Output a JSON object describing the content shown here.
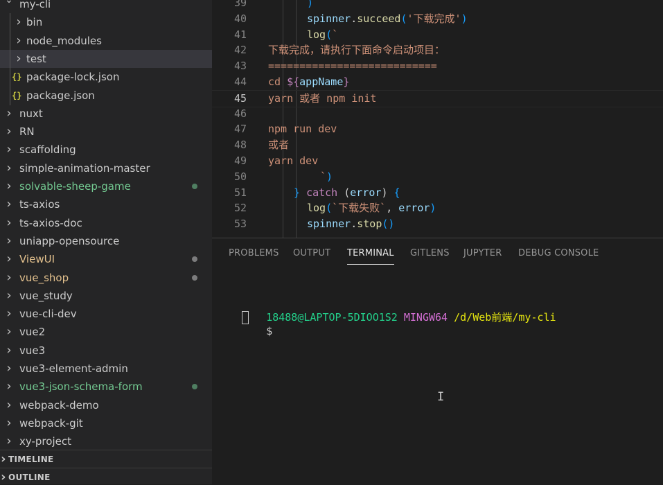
{
  "explorer": {
    "root_folder": "my-cli",
    "root_children": [
      {
        "label": "bin",
        "kind": "folder",
        "selected": false
      },
      {
        "label": "node_modules",
        "kind": "folder",
        "selected": false
      },
      {
        "label": "test",
        "kind": "folder",
        "selected": true
      },
      {
        "label": "package-lock.json",
        "kind": "json",
        "json_icon": "{}",
        "selected": false
      },
      {
        "label": "package.json",
        "kind": "json",
        "json_icon": "{}",
        "selected": false
      }
    ],
    "folders": [
      {
        "label": "nuxt",
        "color": "#cccccc",
        "modified": false
      },
      {
        "label": "RN",
        "color": "#cccccc",
        "modified": false
      },
      {
        "label": "scaffolding",
        "color": "#cccccc",
        "modified": false
      },
      {
        "label": "simple-animation-master",
        "color": "#cccccc",
        "modified": false
      },
      {
        "label": "solvable-sheep-game",
        "color": "#73c991",
        "modified": true,
        "dot_color": "#73c991"
      },
      {
        "label": "ts-axios",
        "color": "#cccccc",
        "modified": false
      },
      {
        "label": "ts-axios-doc",
        "color": "#cccccc",
        "modified": false
      },
      {
        "label": "uniapp-opensource",
        "color": "#cccccc",
        "modified": false
      },
      {
        "label": "ViewUI",
        "color": "#e2c08d",
        "modified": true,
        "dot_color": "#c5c5c5"
      },
      {
        "label": "vue_shop",
        "color": "#e2c08d",
        "modified": true,
        "dot_color": "#c5c5c5"
      },
      {
        "label": "vue_study",
        "color": "#cccccc",
        "modified": false
      },
      {
        "label": "vue-cli-dev",
        "color": "#cccccc",
        "modified": false
      },
      {
        "label": "vue2",
        "color": "#cccccc",
        "modified": false
      },
      {
        "label": "vue3",
        "color": "#cccccc",
        "modified": false
      },
      {
        "label": "vue3-element-admin",
        "color": "#cccccc",
        "modified": false
      },
      {
        "label": "vue3-json-schema-form",
        "color": "#73c991",
        "modified": true,
        "dot_color": "#73c991"
      },
      {
        "label": "webpack-demo",
        "color": "#cccccc",
        "modified": false
      },
      {
        "label": "webpack-git",
        "color": "#cccccc",
        "modified": false
      },
      {
        "label": "xy-project",
        "color": "#cccccc",
        "modified": false
      }
    ]
  },
  "panels": {
    "timeline": "TIMELINE",
    "outline": "OUTLINE"
  },
  "editor": {
    "active_line": "45",
    "lines": [
      {
        "n": "39",
        "tokens": [
          {
            "t": ")",
            "c": "t-paren2"
          }
        ]
      },
      {
        "n": "40",
        "tokens": [
          {
            "t": "spinner",
            "c": "t-var"
          },
          {
            "t": ".",
            "c": "t-plain"
          },
          {
            "t": "succeed",
            "c": "t-fn"
          },
          {
            "t": "(",
            "c": "t-paren2"
          },
          {
            "t": "'下载完成'",
            "c": "t-str"
          },
          {
            "t": ")",
            "c": "t-paren2"
          }
        ]
      },
      {
        "n": "41",
        "tokens": [
          {
            "t": "log",
            "c": "t-fn"
          },
          {
            "t": "(",
            "c": "t-paren2"
          },
          {
            "t": "`",
            "c": "t-str"
          }
        ]
      },
      {
        "n": "42",
        "tokens": [
          {
            "t": "下载完成，请执行下面命令启动项目：",
            "c": "t-str"
          }
        ]
      },
      {
        "n": "43",
        "tokens": [
          {
            "t": "===========================",
            "c": "t-str"
          }
        ]
      },
      {
        "n": "44",
        "tokens": [
          {
            "t": "cd ",
            "c": "t-str"
          },
          {
            "t": "${",
            "c": "t-kw"
          },
          {
            "t": "appName",
            "c": "t-var"
          },
          {
            "t": "}",
            "c": "t-kw"
          }
        ]
      },
      {
        "n": "45",
        "tokens": [
          {
            "t": "yarn 或者 npm init",
            "c": "t-str"
          }
        ]
      },
      {
        "n": "46",
        "tokens": []
      },
      {
        "n": "47",
        "tokens": [
          {
            "t": "npm run dev",
            "c": "t-str"
          }
        ]
      },
      {
        "n": "48",
        "tokens": [
          {
            "t": "或者",
            "c": "t-str"
          }
        ]
      },
      {
        "n": "49",
        "tokens": [
          {
            "t": "yarn dev",
            "c": "t-str"
          }
        ]
      },
      {
        "n": "50",
        "tokens": [
          {
            "t": "`",
            "c": "t-str"
          },
          {
            "t": ")",
            "c": "t-paren2"
          }
        ]
      },
      {
        "n": "51",
        "tokens": [
          {
            "t": "} ",
            "c": "t-paren2"
          },
          {
            "t": "catch",
            "c": "t-kw"
          },
          {
            "t": " (",
            "c": "t-plain"
          },
          {
            "t": "error",
            "c": "t-var"
          },
          {
            "t": ") ",
            "c": "t-plain"
          },
          {
            "t": "{",
            "c": "t-paren2"
          }
        ]
      },
      {
        "n": "52",
        "tokens": [
          {
            "t": "log",
            "c": "t-fn"
          },
          {
            "t": "(",
            "c": "t-paren2"
          },
          {
            "t": "`下载失败`",
            "c": "t-str"
          },
          {
            "t": ", ",
            "c": "t-plain"
          },
          {
            "t": "error",
            "c": "t-var"
          },
          {
            "t": ")",
            "c": "t-paren2"
          }
        ]
      },
      {
        "n": "53",
        "tokens": [
          {
            "t": "spinner",
            "c": "t-var"
          },
          {
            "t": ".",
            "c": "t-plain"
          },
          {
            "t": "stop",
            "c": "t-fn"
          },
          {
            "t": "()",
            "c": "t-paren2"
          }
        ]
      }
    ]
  },
  "panel_tabs": [
    {
      "label": "PROBLEMS",
      "active": false
    },
    {
      "label": "OUTPUT",
      "active": false
    },
    {
      "label": "TERMINAL",
      "active": true
    },
    {
      "label": "GITLENS",
      "active": false
    },
    {
      "label": "JUPYTER",
      "active": false
    },
    {
      "label": "DEBUG CONSOLE",
      "active": false
    }
  ],
  "terminal": {
    "user_host": "18488@LAPTOP-5DIOO1S2",
    "shell": "MINGW64",
    "path": "/d/Web前端/my-cli",
    "prompt": "$",
    "colors": {
      "user_host": "#23d18b",
      "shell": "#d670d6",
      "path": "#e5e510"
    }
  },
  "colors": {
    "sidebar_bg": "#252526",
    "editor_bg": "#1e1e1e",
    "selected_row": "#37373d"
  }
}
